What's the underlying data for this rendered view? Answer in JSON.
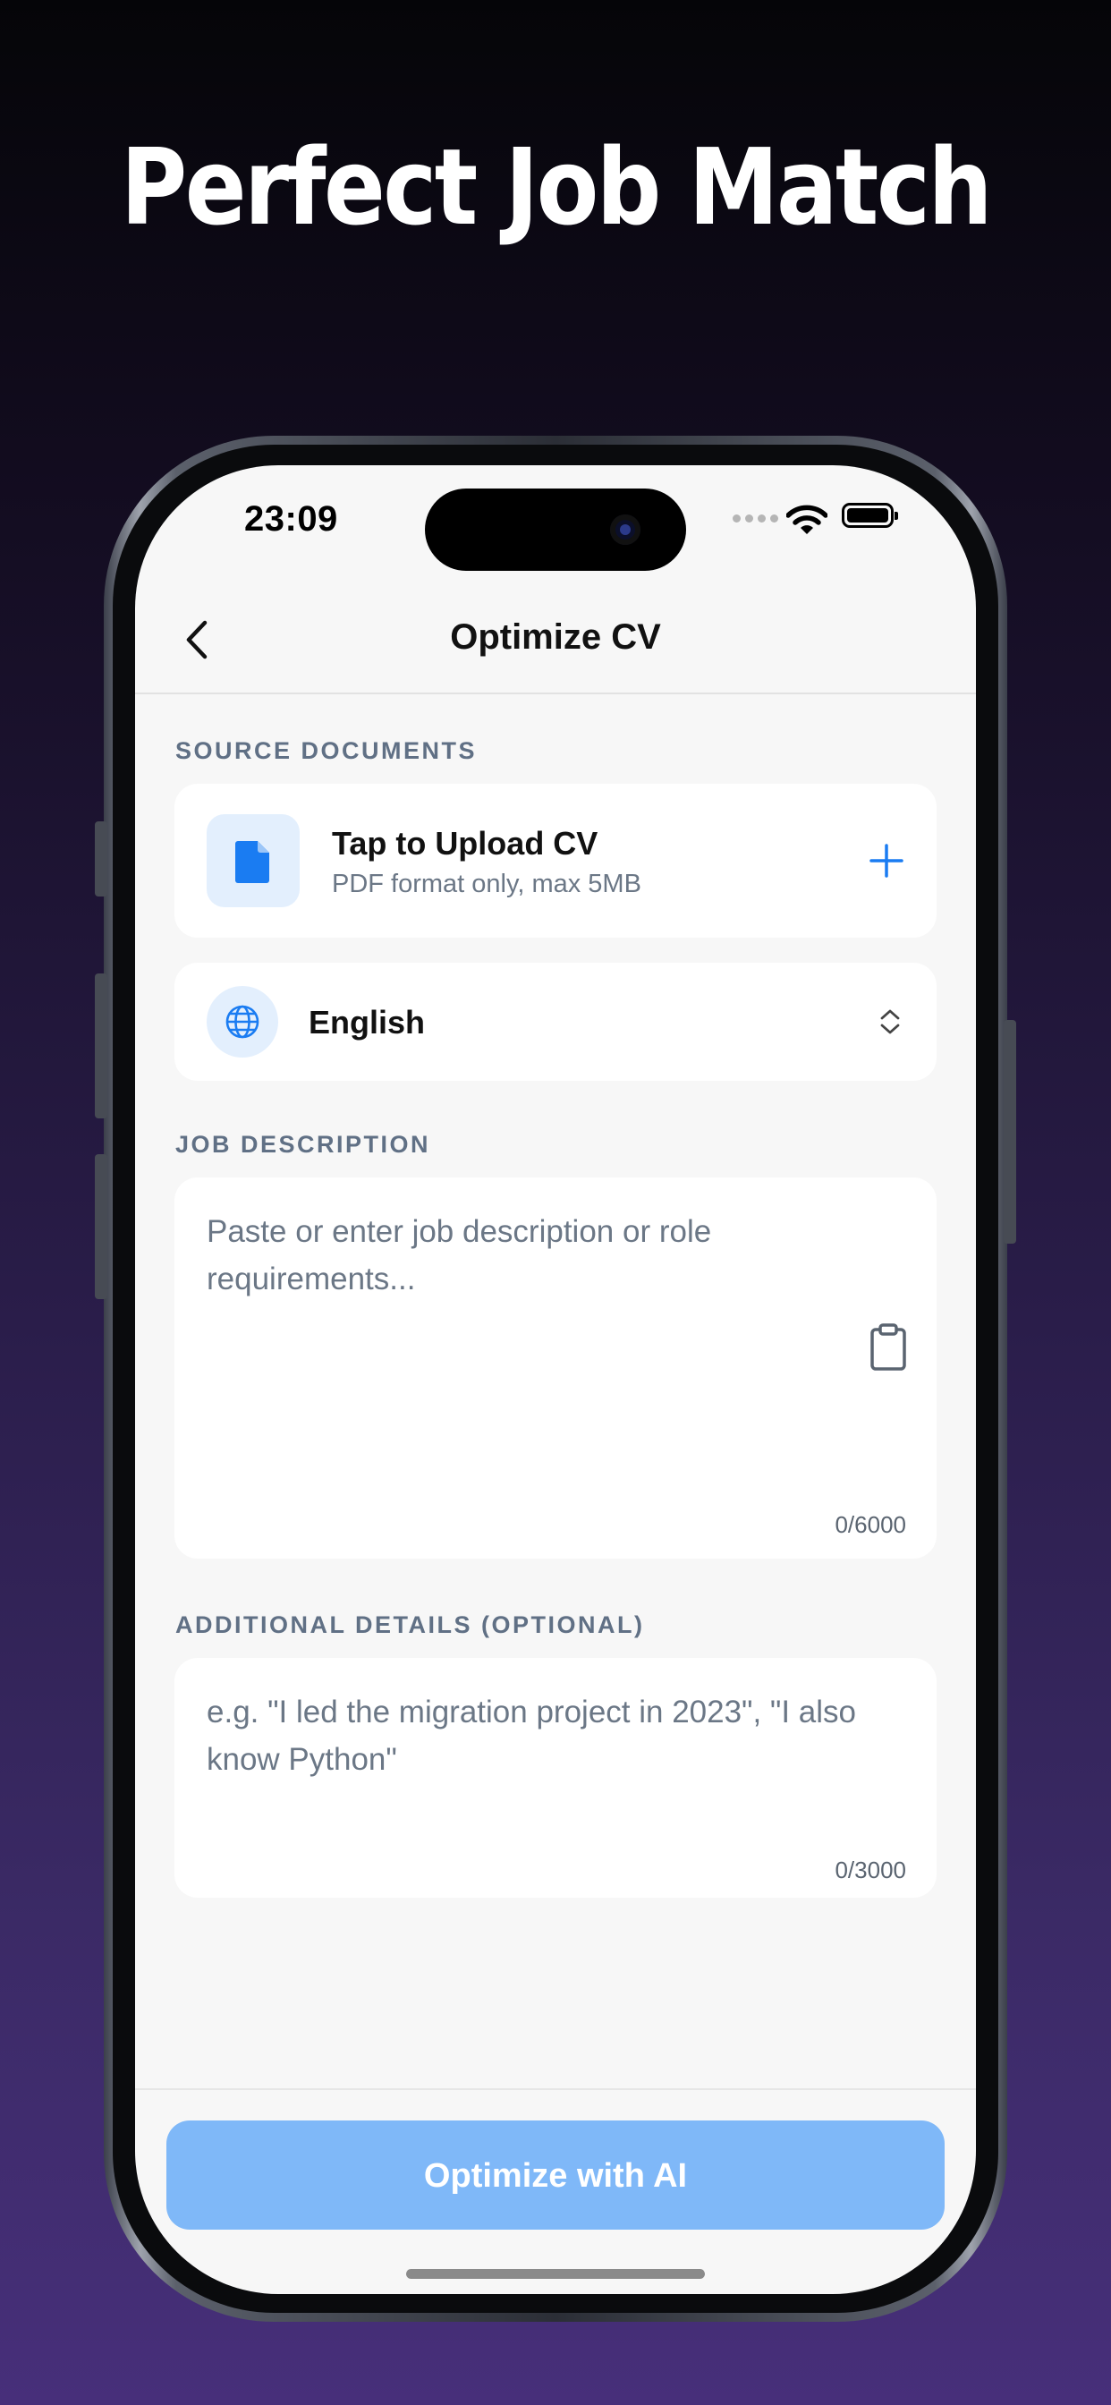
{
  "headline": "Perfect Job Match",
  "status_bar": {
    "time": "23:09"
  },
  "nav": {
    "title": "Optimize CV",
    "back_icon": "chevron-left-icon"
  },
  "source_documents": {
    "label": "SOURCE DOCUMENTS",
    "upload": {
      "title": "Tap to Upload CV",
      "subtitle": "PDF format only, max 5MB",
      "icon": "document-icon",
      "action_icon": "plus-icon"
    },
    "language": {
      "value": "English",
      "icon": "globe-icon",
      "selector_icon": "chevron-up-down-icon"
    }
  },
  "job_description": {
    "label": "JOB DESCRIPTION",
    "placeholder": "Paste or enter job description or role requirements...",
    "value": "",
    "counter": "0/6000",
    "paste_icon": "clipboard-icon"
  },
  "additional_details": {
    "label": "ADDITIONAL DETAILS (OPTIONAL)",
    "placeholder": "e.g. \"I led the migration project in 2023\", \"I also know Python\"",
    "value": "",
    "counter": "0/3000"
  },
  "cta": {
    "label": "Optimize with AI"
  },
  "colors": {
    "accent": "#1a7cf2",
    "cta_disabled": "#7fb8f8",
    "label": "#607085",
    "screen_bg": "#f7f7f7"
  }
}
